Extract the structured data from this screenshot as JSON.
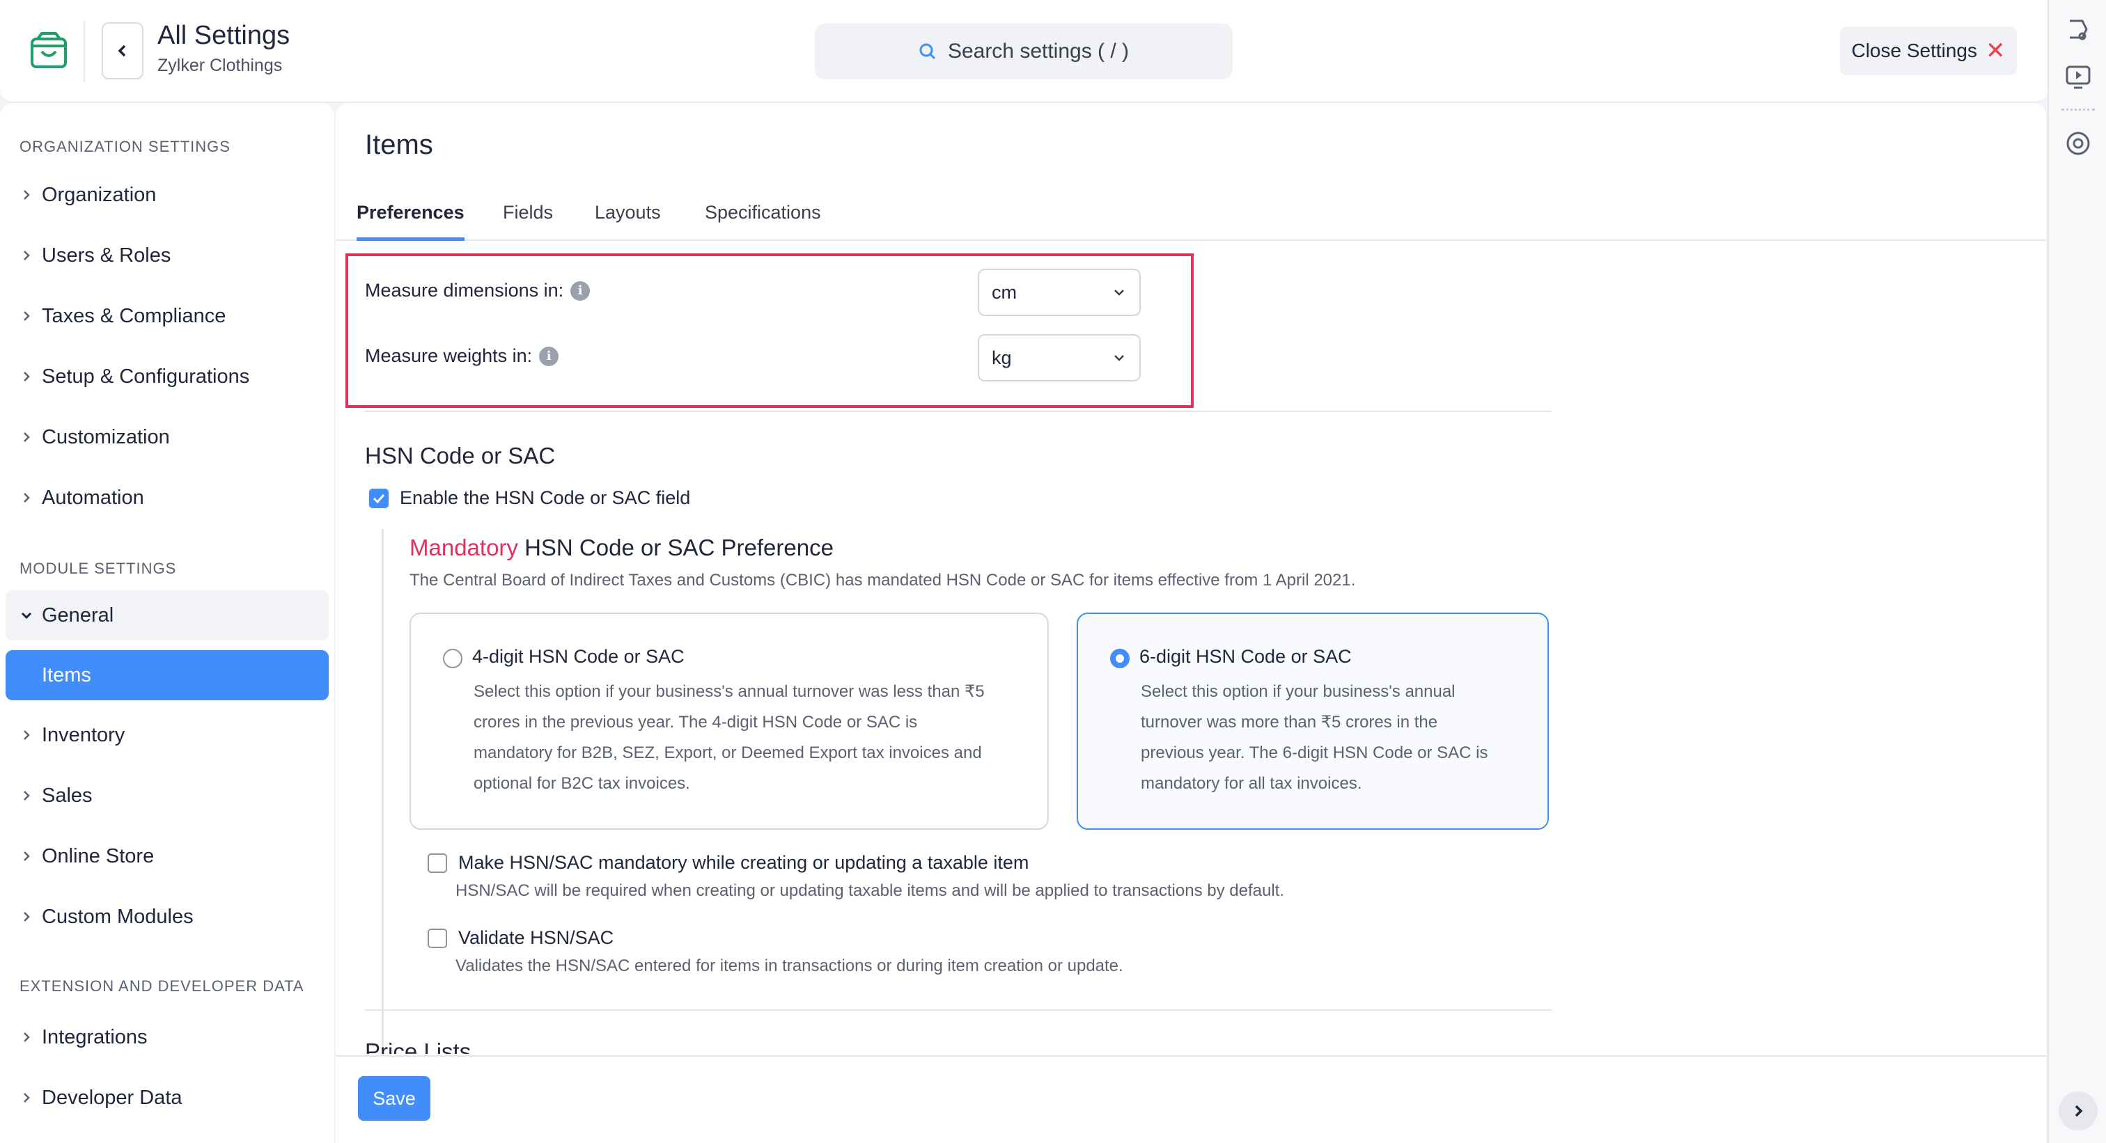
{
  "header": {
    "title": "All Settings",
    "subtitle": "Zylker Clothings",
    "search_placeholder": "Search settings ( / )",
    "close_label": "Close Settings"
  },
  "sidebar": {
    "org_heading": "ORGANIZATION SETTINGS",
    "org_items": [
      "Organization",
      "Users & Roles",
      "Taxes & Compliance",
      "Setup & Configurations",
      "Customization",
      "Automation"
    ],
    "module_heading": "MODULE SETTINGS",
    "general_label": "General",
    "active_item": "Items",
    "module_items": [
      "Inventory",
      "Sales",
      "Online Store",
      "Custom Modules"
    ],
    "ext_heading": "EXTENSION AND DEVELOPER DATA",
    "ext_items": [
      "Integrations",
      "Developer Data"
    ]
  },
  "main": {
    "title": "Items",
    "tabs": [
      "Preferences",
      "Fields",
      "Layouts",
      "Specifications"
    ],
    "dimensions_label": "Measure dimensions in:",
    "dimensions_value": "cm",
    "weights_label": "Measure weights in:",
    "weights_value": "kg",
    "hsn_heading": "HSN Code or SAC",
    "hsn_enable_label": "Enable the HSN Code or SAC field",
    "mandatory_word": "Mandatory",
    "mandatory_rest": "HSN Code or SAC Preference",
    "mandatory_desc": "The Central Board of Indirect Taxes and Customs (CBIC) has mandated HSN Code or SAC for items effective from 1 April 2021.",
    "option4_title": "4-digit HSN Code or SAC",
    "option4_lines": [
      "Select this option if your business's annual turnover was less than ₹5",
      "crores in the previous year. The 4-digit HSN Code or SAC is",
      "mandatory for B2B, SEZ, Export, or Deemed Export tax invoices and",
      "optional for B2C tax invoices."
    ],
    "option6_title": "6-digit HSN Code or SAC",
    "option6_lines": [
      "Select this option if your business's annual",
      "turnover was more than ₹5 crores in the",
      "previous year. The 6-digit HSN Code or SAC is",
      "mandatory for all tax invoices."
    ],
    "mandatory_check_label": "Make HSN/SAC mandatory while creating or updating a taxable item",
    "mandatory_check_desc": "HSN/SAC will be required when creating or updating taxable items and will be applied to transactions by default.",
    "validate_label": "Validate HSN/SAC",
    "validate_desc": "Validates the HSN/SAC entered for items in transactions or during item creation or update.",
    "next_section": "Price Lists",
    "save_label": "Save"
  },
  "colors": {
    "accent": "#408dfb",
    "highlight": "#e2305d",
    "close_x": "#e8414b"
  }
}
